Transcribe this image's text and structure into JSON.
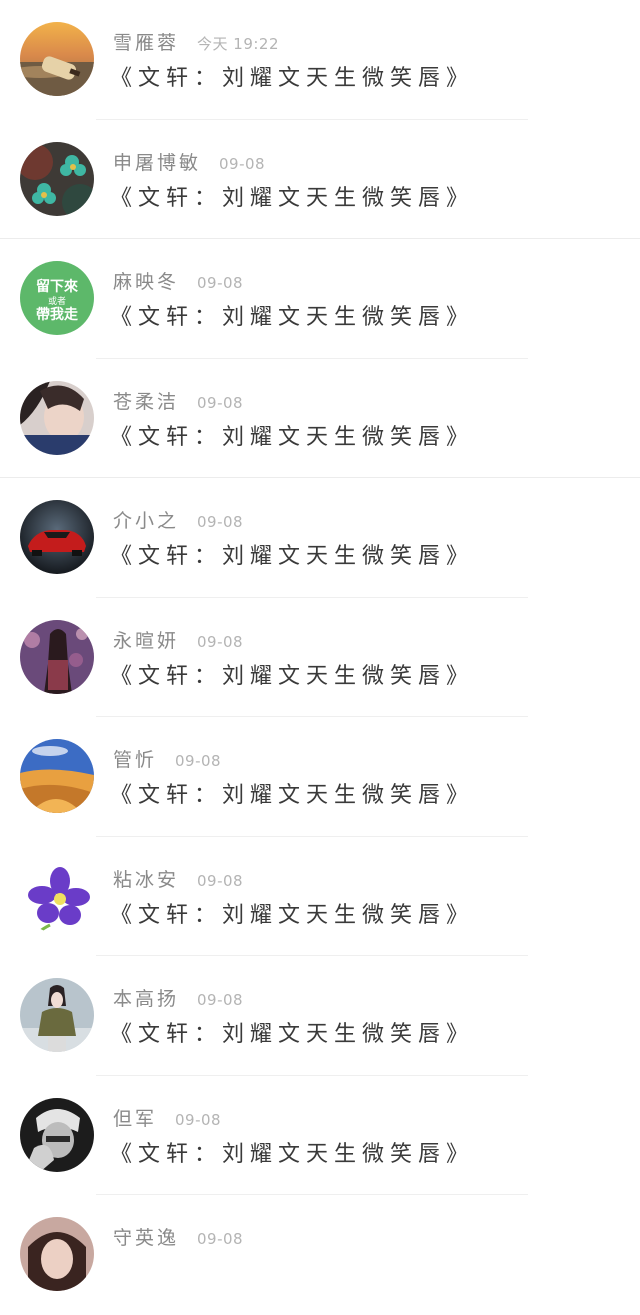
{
  "messages": [
    {
      "name": "雪雁蓉",
      "time": "今天 19:22",
      "text": "《文轩：刘耀文天生微笑唇》",
      "avatar_icon": "bottle-on-beach-photo"
    },
    {
      "name": "申屠博敏",
      "time": "09-08",
      "text": "《文轩：刘耀文天生微笑唇》",
      "avatar_icon": "teal-flowers-photo"
    },
    {
      "name": "麻映冬",
      "time": "09-08",
      "text": "《文轩：刘耀文天生微笑唇》",
      "avatar_icon": "green-text-badge",
      "avatar_text": [
        "留下來",
        "或者",
        "帶我走"
      ]
    },
    {
      "name": "苍柔洁",
      "time": "09-08",
      "text": "《文轩：刘耀文天生微笑唇》",
      "avatar_icon": "girl-portrait-photo"
    },
    {
      "name": "介小之",
      "time": "09-08",
      "text": "《文轩：刘耀文天生微笑唇》",
      "avatar_icon": "red-sports-car-photo"
    },
    {
      "name": "永暄妍",
      "time": "09-08",
      "text": "《文轩：刘耀文天生微笑唇》",
      "avatar_icon": "girl-city-night-photo"
    },
    {
      "name": "管忻",
      "time": "09-08",
      "text": "《文轩：刘耀文天生微笑唇》",
      "avatar_icon": "desert-dunes-photo"
    },
    {
      "name": "粘冰安",
      "time": "09-08",
      "text": "《文轩：刘耀文天生微笑唇》",
      "avatar_icon": "purple-orchid-photo"
    },
    {
      "name": "本高扬",
      "time": "09-08",
      "text": "《文轩：刘耀文天生微笑唇》",
      "avatar_icon": "girl-winter-photo"
    },
    {
      "name": "但军",
      "time": "09-08",
      "text": "《文轩：刘耀文天生微笑唇》",
      "avatar_icon": "monochrome-boy-photo"
    },
    {
      "name": "守英逸",
      "time": "09-08",
      "text": "",
      "avatar_icon": "girl-portrait-photo-2"
    }
  ]
}
